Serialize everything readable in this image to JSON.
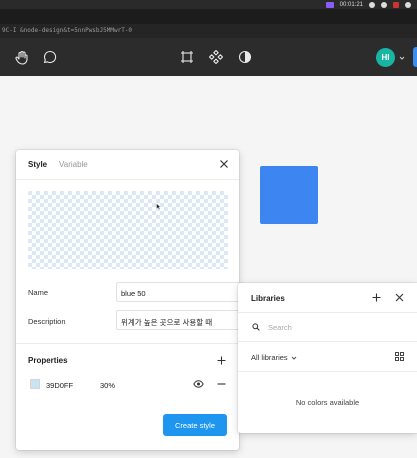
{
  "browser": {
    "url": "9C-I &node-design&t=5nnPwsbJ5MMwrT-0"
  },
  "menubar": {
    "clock": "00:01:21"
  },
  "toolbar": {
    "avatar_initials": "HI",
    "icons": [
      "hand-icon",
      "comment-icon",
      "frame-icon",
      "component-icon",
      "contrast-icon"
    ]
  },
  "style_dialog": {
    "tabs": [
      {
        "label": "Style",
        "active": true
      },
      {
        "label": "Variable",
        "active": false
      }
    ],
    "name_label": "Name",
    "name_value": "blue 50",
    "description_label": "Description",
    "description_value": "위계가 높은 곳으로 사용할 때",
    "properties_title": "Properties",
    "fill": {
      "hex": "39D0FF",
      "opacity": "30%"
    },
    "create_button": "Create style"
  },
  "libraries_panel": {
    "title": "Libraries",
    "search_placeholder": "Search",
    "filter_label": "All libraries",
    "empty_message": "No colors available"
  },
  "colors": {
    "accent": "#1e96f0",
    "canvas_square": "#3d85f0",
    "avatar": "#18b4a4"
  }
}
